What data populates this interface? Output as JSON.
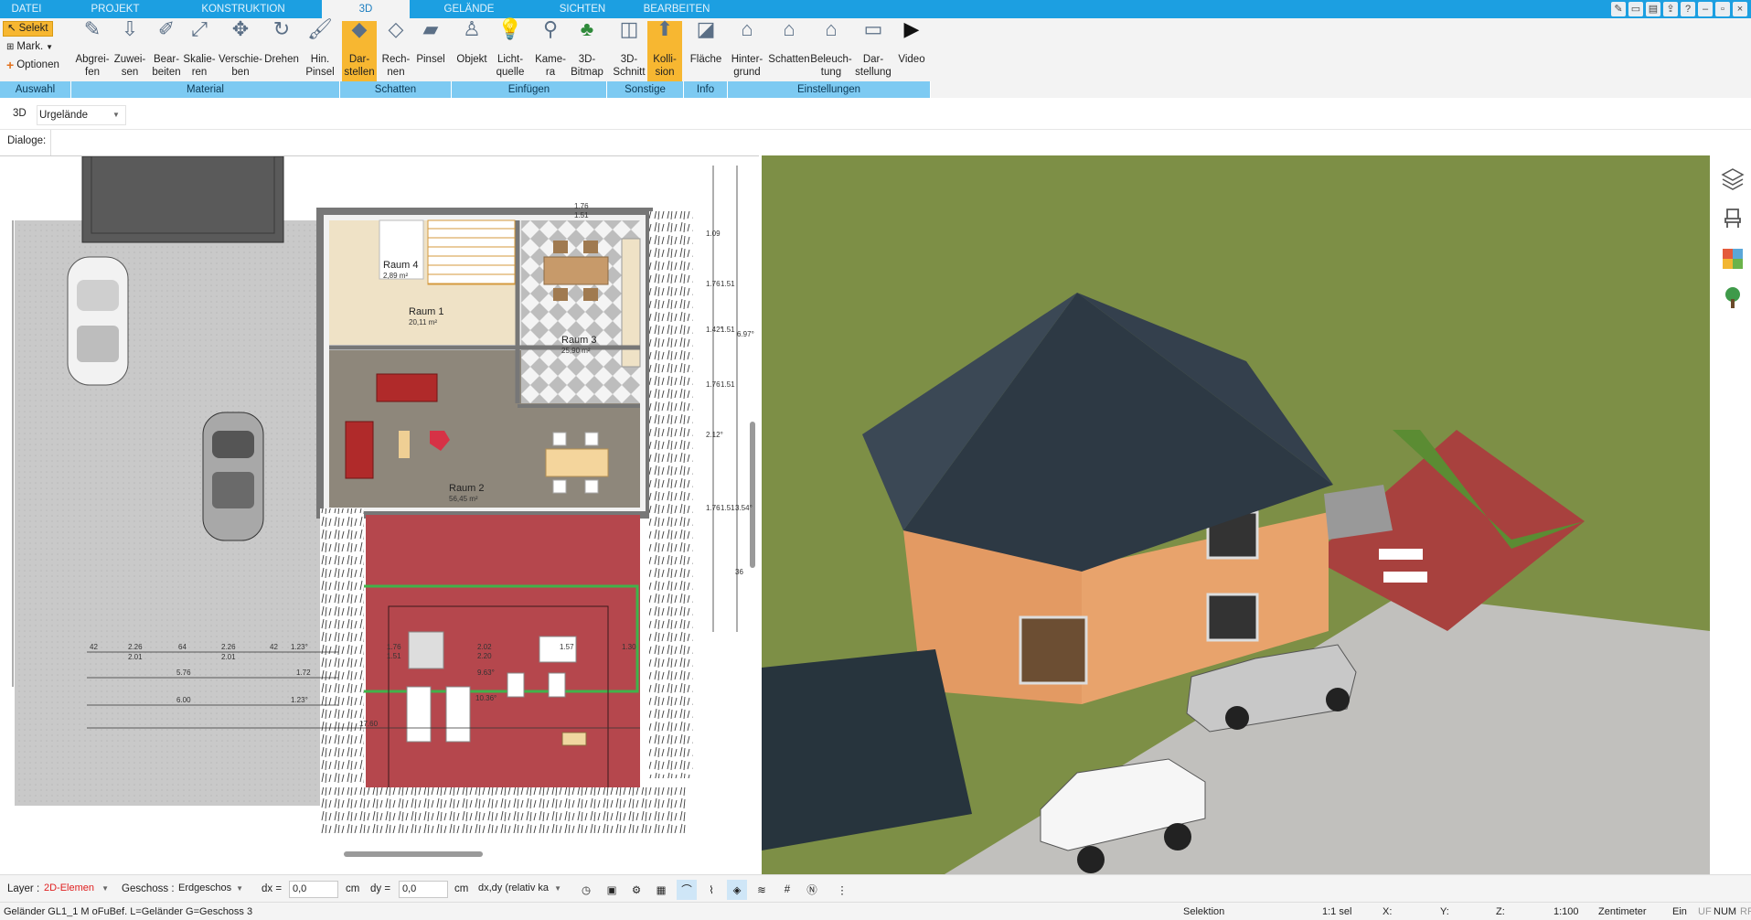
{
  "tabs": [
    "DATEI",
    "PROJEKT",
    "KONSTRUKTION",
    "3D",
    "GELÄNDE",
    "SICHTEN",
    "BEARBEITEN"
  ],
  "auswahl": {
    "selekt": "Selekt",
    "mark": "Mark.",
    "optionen": "Optionen"
  },
  "ribbon": [
    {
      "label": "Abgrei-\nfen",
      "icon": "eyedropper-icon"
    },
    {
      "label": "Zuwei-\nsen",
      "icon": "assign-icon"
    },
    {
      "label": "Bear-\nbeiten",
      "icon": "edit-material-icon"
    },
    {
      "label": "Skalie-\nren",
      "icon": "scale-icon"
    },
    {
      "label": "Verschie-\nben",
      "icon": "move-icon"
    },
    {
      "label": "Drehen",
      "icon": "rotate-icon"
    },
    {
      "label": "Hin.\nPinsel",
      "icon": "brush-icon"
    },
    {
      "label": "Dar-\nstellen",
      "icon": "shadow-cube-icon"
    },
    {
      "label": "Rech-\nnen",
      "icon": "calc-cube-icon"
    },
    {
      "label": "Pinsel",
      "icon": "shadow-brush-icon"
    },
    {
      "label": "Objekt",
      "icon": "chair-icon"
    },
    {
      "label": "Licht-\nquelle",
      "icon": "bulb-icon"
    },
    {
      "label": "Kame-\nra",
      "icon": "camera-icon"
    },
    {
      "label": "3D-\nBitmap",
      "icon": "tree-icon"
    },
    {
      "label": "3D-\nSchnitt",
      "icon": "section-icon"
    },
    {
      "label": "Kolli-\nsion",
      "icon": "collision-icon"
    },
    {
      "label": "Fläche",
      "icon": "area-icon"
    },
    {
      "label": "Hinter-\ngrund",
      "icon": "background-icon"
    },
    {
      "label": "Schatten",
      "icon": "house-shadow-icon"
    },
    {
      "label": "Beleuch-\ntung",
      "icon": "lighting-icon"
    },
    {
      "label": "Dar-\nstellung",
      "icon": "monitor-icon"
    },
    {
      "label": "Video",
      "icon": "play-icon"
    }
  ],
  "groups": [
    "Auswahl",
    "Material",
    "Schatten",
    "Einfügen",
    "Sonstige",
    "Info",
    "Einstellungen"
  ],
  "view_mode": {
    "label": "3D",
    "value": "Urgelände"
  },
  "dialoge": "Dialoge:",
  "rooms": [
    {
      "name": "Raum 4",
      "area": "2,89 m²"
    },
    {
      "name": "Raum 1",
      "area": "20,11 m²"
    },
    {
      "name": "Raum 3",
      "area": "25,90 m²"
    },
    {
      "name": "Raum 2",
      "area": "56,45 m²"
    }
  ],
  "dims": {
    "d1": "42",
    "d2": "2.26",
    "d3": "64",
    "d4": "2.26",
    "d5": "42",
    "d6": "1.23°",
    "d7": "2.01",
    "d8": "2.01",
    "d9": "5.76",
    "d10": "1.72",
    "d11": "6.00",
    "d12": "1.23°",
    "d13": "1.76",
    "d14": "1.51",
    "d15": "2.02",
    "d16": "2.20",
    "d17": "1.57",
    "d18": "1.30",
    "d19": "9.63°",
    "d20": "10.36°",
    "d21": "17.60",
    "r1": "1.09",
    "r2": "1.76",
    "r3": "1.51",
    "r4": "1.42°",
    "r5": "1.51",
    "r6": "6.97°",
    "r7": "1.76",
    "r8": "1.51",
    "r9": "2.12°",
    "r10": "1.76",
    "r11": "1.51",
    "r12": "3.54°",
    "r13": "36",
    "t1": "1.76",
    "t2": "1.51"
  },
  "status": {
    "layer_label": "Layer :",
    "layer_value": "2D-Elemen",
    "geschoss_label": "Geschoss :",
    "geschoss_value": "Erdgeschos",
    "dx_label": "dx =",
    "dx_value": "0,0",
    "cm1": "cm",
    "dy_label": "dy =",
    "dy_value": "0,0",
    "cm2": "cm",
    "mode": "dx,dy (relativ ka"
  },
  "info": {
    "left": "Geländer GL1_1 M oFuBef. L=Geländer G=Geschoss 3",
    "selektion": "Selektion",
    "sel": "1:1 sel",
    "x": "X:",
    "y": "Y:",
    "z": "Z:",
    "scale": "1:100",
    "unit": "Zentimeter",
    "ein": "Ein",
    "uf": "UF",
    "num": "NUM",
    "rf": "RF"
  },
  "colors": {
    "accent": "#1c9fe1",
    "highlight": "#f7b731",
    "group": "#7dcaf2",
    "layer_red": "#e02020"
  }
}
